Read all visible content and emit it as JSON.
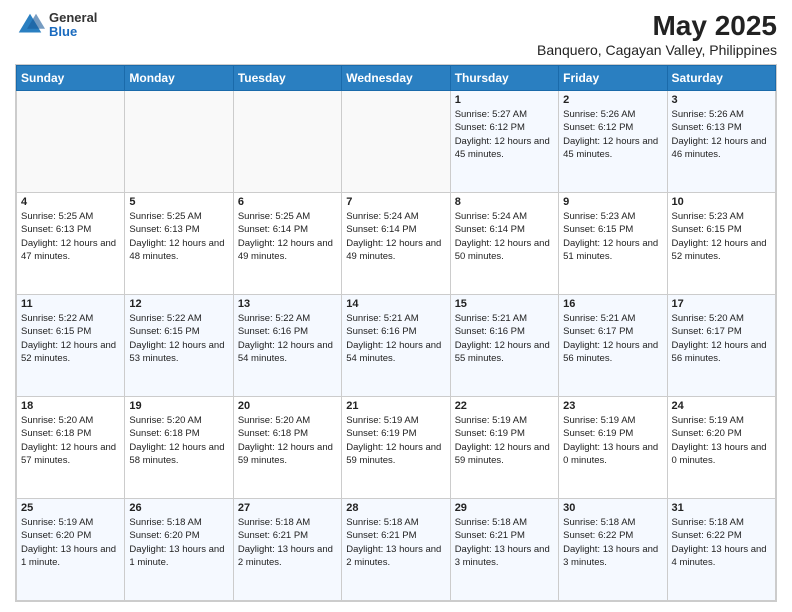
{
  "header": {
    "logo": {
      "general": "General",
      "blue": "Blue"
    },
    "title": "May 2025",
    "subtitle": "Banquero, Cagayan Valley, Philippines"
  },
  "calendar": {
    "days_of_week": [
      "Sunday",
      "Monday",
      "Tuesday",
      "Wednesday",
      "Thursday",
      "Friday",
      "Saturday"
    ],
    "weeks": [
      [
        {
          "day": "",
          "sunrise": "",
          "sunset": "",
          "daylight": ""
        },
        {
          "day": "",
          "sunrise": "",
          "sunset": "",
          "daylight": ""
        },
        {
          "day": "",
          "sunrise": "",
          "sunset": "",
          "daylight": ""
        },
        {
          "day": "",
          "sunrise": "",
          "sunset": "",
          "daylight": ""
        },
        {
          "day": "1",
          "sunrise": "5:27 AM",
          "sunset": "6:12 PM",
          "daylight": "12 hours and 45 minutes."
        },
        {
          "day": "2",
          "sunrise": "5:26 AM",
          "sunset": "6:12 PM",
          "daylight": "12 hours and 45 minutes."
        },
        {
          "day": "3",
          "sunrise": "5:26 AM",
          "sunset": "6:13 PM",
          "daylight": "12 hours and 46 minutes."
        }
      ],
      [
        {
          "day": "4",
          "sunrise": "5:25 AM",
          "sunset": "6:13 PM",
          "daylight": "12 hours and 47 minutes."
        },
        {
          "day": "5",
          "sunrise": "5:25 AM",
          "sunset": "6:13 PM",
          "daylight": "12 hours and 48 minutes."
        },
        {
          "day": "6",
          "sunrise": "5:25 AM",
          "sunset": "6:14 PM",
          "daylight": "12 hours and 49 minutes."
        },
        {
          "day": "7",
          "sunrise": "5:24 AM",
          "sunset": "6:14 PM",
          "daylight": "12 hours and 49 minutes."
        },
        {
          "day": "8",
          "sunrise": "5:24 AM",
          "sunset": "6:14 PM",
          "daylight": "12 hours and 50 minutes."
        },
        {
          "day": "9",
          "sunrise": "5:23 AM",
          "sunset": "6:15 PM",
          "daylight": "12 hours and 51 minutes."
        },
        {
          "day": "10",
          "sunrise": "5:23 AM",
          "sunset": "6:15 PM",
          "daylight": "12 hours and 52 minutes."
        }
      ],
      [
        {
          "day": "11",
          "sunrise": "5:22 AM",
          "sunset": "6:15 PM",
          "daylight": "12 hours and 52 minutes."
        },
        {
          "day": "12",
          "sunrise": "5:22 AM",
          "sunset": "6:15 PM",
          "daylight": "12 hours and 53 minutes."
        },
        {
          "day": "13",
          "sunrise": "5:22 AM",
          "sunset": "6:16 PM",
          "daylight": "12 hours and 54 minutes."
        },
        {
          "day": "14",
          "sunrise": "5:21 AM",
          "sunset": "6:16 PM",
          "daylight": "12 hours and 54 minutes."
        },
        {
          "day": "15",
          "sunrise": "5:21 AM",
          "sunset": "6:16 PM",
          "daylight": "12 hours and 55 minutes."
        },
        {
          "day": "16",
          "sunrise": "5:21 AM",
          "sunset": "6:17 PM",
          "daylight": "12 hours and 56 minutes."
        },
        {
          "day": "17",
          "sunrise": "5:20 AM",
          "sunset": "6:17 PM",
          "daylight": "12 hours and 56 minutes."
        }
      ],
      [
        {
          "day": "18",
          "sunrise": "5:20 AM",
          "sunset": "6:18 PM",
          "daylight": "12 hours and 57 minutes."
        },
        {
          "day": "19",
          "sunrise": "5:20 AM",
          "sunset": "6:18 PM",
          "daylight": "12 hours and 58 minutes."
        },
        {
          "day": "20",
          "sunrise": "5:20 AM",
          "sunset": "6:18 PM",
          "daylight": "12 hours and 59 minutes."
        },
        {
          "day": "21",
          "sunrise": "5:19 AM",
          "sunset": "6:19 PM",
          "daylight": "12 hours and 59 minutes."
        },
        {
          "day": "22",
          "sunrise": "5:19 AM",
          "sunset": "6:19 PM",
          "daylight": "12 hours and 59 minutes."
        },
        {
          "day": "23",
          "sunrise": "5:19 AM",
          "sunset": "6:19 PM",
          "daylight": "13 hours and 0 minutes."
        },
        {
          "day": "24",
          "sunrise": "5:19 AM",
          "sunset": "6:20 PM",
          "daylight": "13 hours and 0 minutes."
        }
      ],
      [
        {
          "day": "25",
          "sunrise": "5:19 AM",
          "sunset": "6:20 PM",
          "daylight": "13 hours and 1 minute."
        },
        {
          "day": "26",
          "sunrise": "5:18 AM",
          "sunset": "6:20 PM",
          "daylight": "13 hours and 1 minute."
        },
        {
          "day": "27",
          "sunrise": "5:18 AM",
          "sunset": "6:21 PM",
          "daylight": "13 hours and 2 minutes."
        },
        {
          "day": "28",
          "sunrise": "5:18 AM",
          "sunset": "6:21 PM",
          "daylight": "13 hours and 2 minutes."
        },
        {
          "day": "29",
          "sunrise": "5:18 AM",
          "sunset": "6:21 PM",
          "daylight": "13 hours and 3 minutes."
        },
        {
          "day": "30",
          "sunrise": "5:18 AM",
          "sunset": "6:22 PM",
          "daylight": "13 hours and 3 minutes."
        },
        {
          "day": "31",
          "sunrise": "5:18 AM",
          "sunset": "6:22 PM",
          "daylight": "13 hours and 4 minutes."
        }
      ]
    ]
  }
}
